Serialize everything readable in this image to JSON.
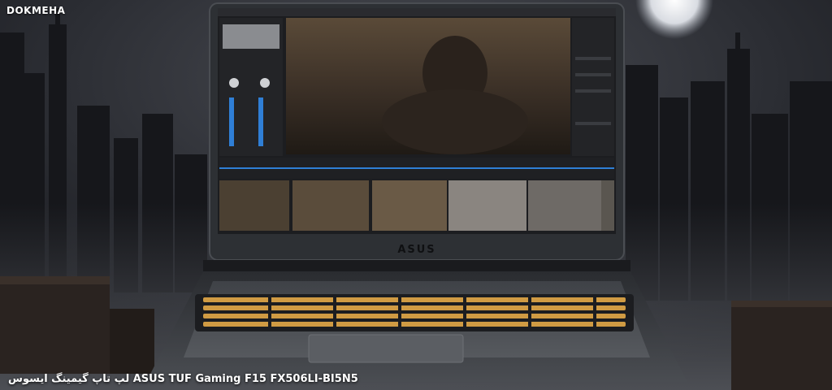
{
  "site": {
    "watermark": "DOKMEHA"
  },
  "product": {
    "caption": "لپ تاپ گیمینگ ایسوس ASUS TUF Gaming F15 FX506LI-BI5N5"
  },
  "laptop": {
    "logo_text": "ASUS"
  },
  "palette": {
    "background_sky": "#2b2d33",
    "moon": "#e8eaee",
    "laptop_body": "#3a3d42",
    "keyboard_backlight": "#f0b14a"
  }
}
